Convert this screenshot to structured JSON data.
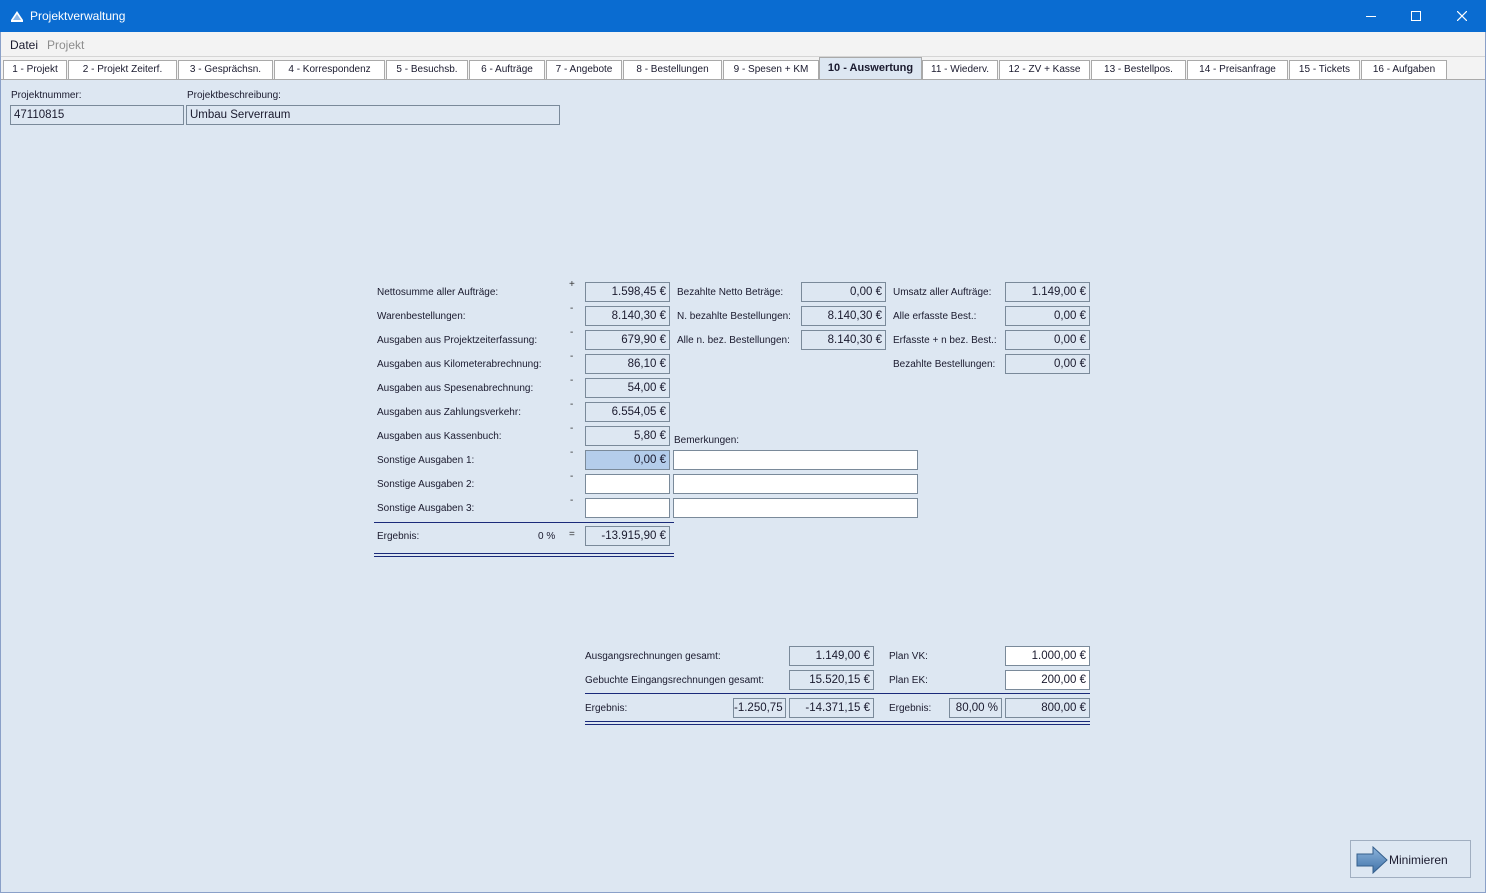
{
  "window": {
    "title": "Projektverwaltung"
  },
  "menu": {
    "datei": "Datei",
    "projekt": "Projekt"
  },
  "tabs": [
    "1 - Projekt",
    "2 - Projekt Zeiterf.",
    "3 - Gesprächsn.",
    "4 - Korrespondenz",
    "5 - Besuchsb.",
    "6 - Aufträge",
    "7 - Angebote",
    "8 - Bestellungen",
    "9 - Spesen + KM",
    "10 - Auswertung",
    "11 - Wiederv.",
    "12 - ZV + Kasse",
    "13 - Bestellpos.",
    "14 - Preisanfrage",
    "15 - Tickets",
    "16 - Aufgaben"
  ],
  "header": {
    "projektnummer_label": "Projektnummer:",
    "projektnummer": "47110815",
    "beschreibung_label": "Projektbeschreibung:",
    "beschreibung": "Umbau Serverraum"
  },
  "left": {
    "rows": [
      {
        "label": "Nettosumme aller Aufträge:",
        "sign": "+",
        "value": "1.598,45 €"
      },
      {
        "label": "Warenbestellungen:",
        "sign": "-",
        "value": "8.140,30 €"
      },
      {
        "label": "Ausgaben aus Projektzeiterfassung:",
        "sign": "-",
        "value": "679,90 €"
      },
      {
        "label": "Ausgaben aus Kilometerabrechnung:",
        "sign": "-",
        "value": "86,10 €"
      },
      {
        "label": "Ausgaben aus Spesenabrechnung:",
        "sign": "-",
        "value": "54,00 €"
      },
      {
        "label": "Ausgaben aus Zahlungsverkehr:",
        "sign": "-",
        "value": "6.554,05 €"
      },
      {
        "label": "Ausgaben aus Kassenbuch:",
        "sign": "-",
        "value": "5,80 €"
      },
      {
        "label": "Sonstige Ausgaben 1:",
        "sign": "-",
        "value": "0,00 €"
      },
      {
        "label": "Sonstige Ausgaben 2:",
        "sign": "-",
        "value": ""
      },
      {
        "label": "Sonstige Ausgaben 3:",
        "sign": "-",
        "value": ""
      }
    ],
    "ergebnis_label": "Ergebnis:",
    "ergebnis_percent": "0 %",
    "ergebnis_sign": "=",
    "ergebnis_value": "-13.915,90 €"
  },
  "middle": {
    "rows": [
      {
        "label": "Bezahlte Netto Beträge:",
        "value": "0,00 €"
      },
      {
        "label": "N. bezahlte Bestellungen:",
        "value": "8.140,30 €"
      },
      {
        "label": "Alle n. bez. Bestellungen:",
        "value": "8.140,30 €"
      }
    ],
    "bemerkungen_label": "Bemerkungen:",
    "bemerkungen": [
      "",
      "",
      ""
    ]
  },
  "right": {
    "rows": [
      {
        "label": "Umsatz aller Aufträge:",
        "value": "1.149,00 €"
      },
      {
        "label": "Alle erfasste Best.:",
        "value": "0,00 €"
      },
      {
        "label": "Erfasste + n bez. Best.:",
        "value": "0,00 €"
      },
      {
        "label": "Bezahlte Bestellungen:",
        "value": "0,00 €"
      }
    ]
  },
  "bottom": {
    "ausgang_label": "Ausgangsrechnungen gesamt:",
    "ausgang_value": "1.149,00 €",
    "eingang_label": "Gebuchte Eingangsrechnungen gesamt:",
    "eingang_value": "15.520,15 €",
    "ergebnis_label": "Ergebnis:",
    "ergebnis_a": "-1.250,75",
    "ergebnis_b": "-14.371,15 €",
    "plan_vk_label": "Plan VK:",
    "plan_vk": "1.000,00 €",
    "plan_ek_label": "Plan EK:",
    "plan_ek": "200,00 €",
    "plan_ergebnis_label": "Ergebnis:",
    "plan_percent": "80,00 %",
    "plan_value": "800,00 €"
  },
  "buttons": {
    "minimieren": "Minimieren"
  },
  "colors": {
    "titlebar": "#0a6cd1",
    "background": "#dde7f2",
    "selection": "#b4cdeb",
    "rule": "#1a2a7a"
  }
}
